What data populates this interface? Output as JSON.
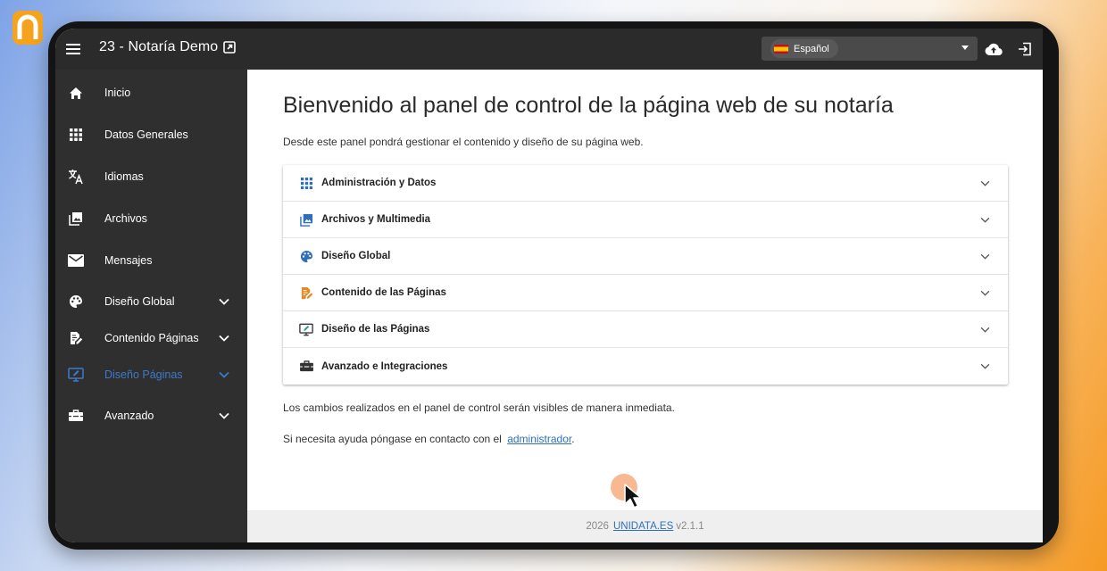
{
  "app": {
    "title": "23 - Notaría Demo"
  },
  "header": {
    "language_selected": "Español"
  },
  "sidebar": {
    "items": [
      {
        "label": "Inicio",
        "icon": "home-icon"
      },
      {
        "label": "Datos Generales",
        "icon": "grid-icon"
      },
      {
        "label": "Idiomas",
        "icon": "translate-icon"
      },
      {
        "label": "Archivos",
        "icon": "image-library-icon"
      },
      {
        "label": "Mensajes",
        "icon": "mail-icon"
      },
      {
        "label": "Diseño Global",
        "icon": "palette-icon",
        "expandable": true
      },
      {
        "label": "Contenido Páginas",
        "icon": "edit-document-icon",
        "expandable": true
      },
      {
        "label": "Diseño Páginas",
        "icon": "monitor-edit-icon",
        "expandable": true,
        "active": true
      },
      {
        "label": "Avanzado",
        "icon": "toolbox-icon",
        "expandable": true
      }
    ]
  },
  "main": {
    "title": "Bienvenido al panel de control de la página web de su notaría",
    "description": "Desde este panel pondrá gestionar el contenido y diseño de su página web.",
    "sections": [
      {
        "label": "Administración y Datos",
        "icon": "grid-icon"
      },
      {
        "label": "Archivos y Multimedia",
        "icon": "image-library-icon"
      },
      {
        "label": "Diseño Global",
        "icon": "palette-icon"
      },
      {
        "label": "Contenido de las Páginas",
        "icon": "edit-document-icon"
      },
      {
        "label": "Diseño de las Páginas",
        "icon": "monitor-edit-icon"
      },
      {
        "label": "Avanzado e Integraciones",
        "icon": "toolbox-icon"
      }
    ],
    "info_changes": "Los cambios realizados en el panel de control serán visibles de manera inmediata.",
    "help_text": "Si necesita ayuda póngase en contacto con el",
    "help_link": "administrador",
    "help_suffix": "."
  },
  "footer": {
    "year": "2026",
    "link": "UNIDATA.ES",
    "version": "v2.1.1"
  },
  "colors": {
    "topbar": "#2b2b2b",
    "sidebar": "#2f2f2f",
    "accent": "#3d7ac8",
    "section_icon_blue": "#2f6fb9",
    "section_icon_orange": "#e08a2a",
    "brand_orange": "#f5a21d"
  }
}
